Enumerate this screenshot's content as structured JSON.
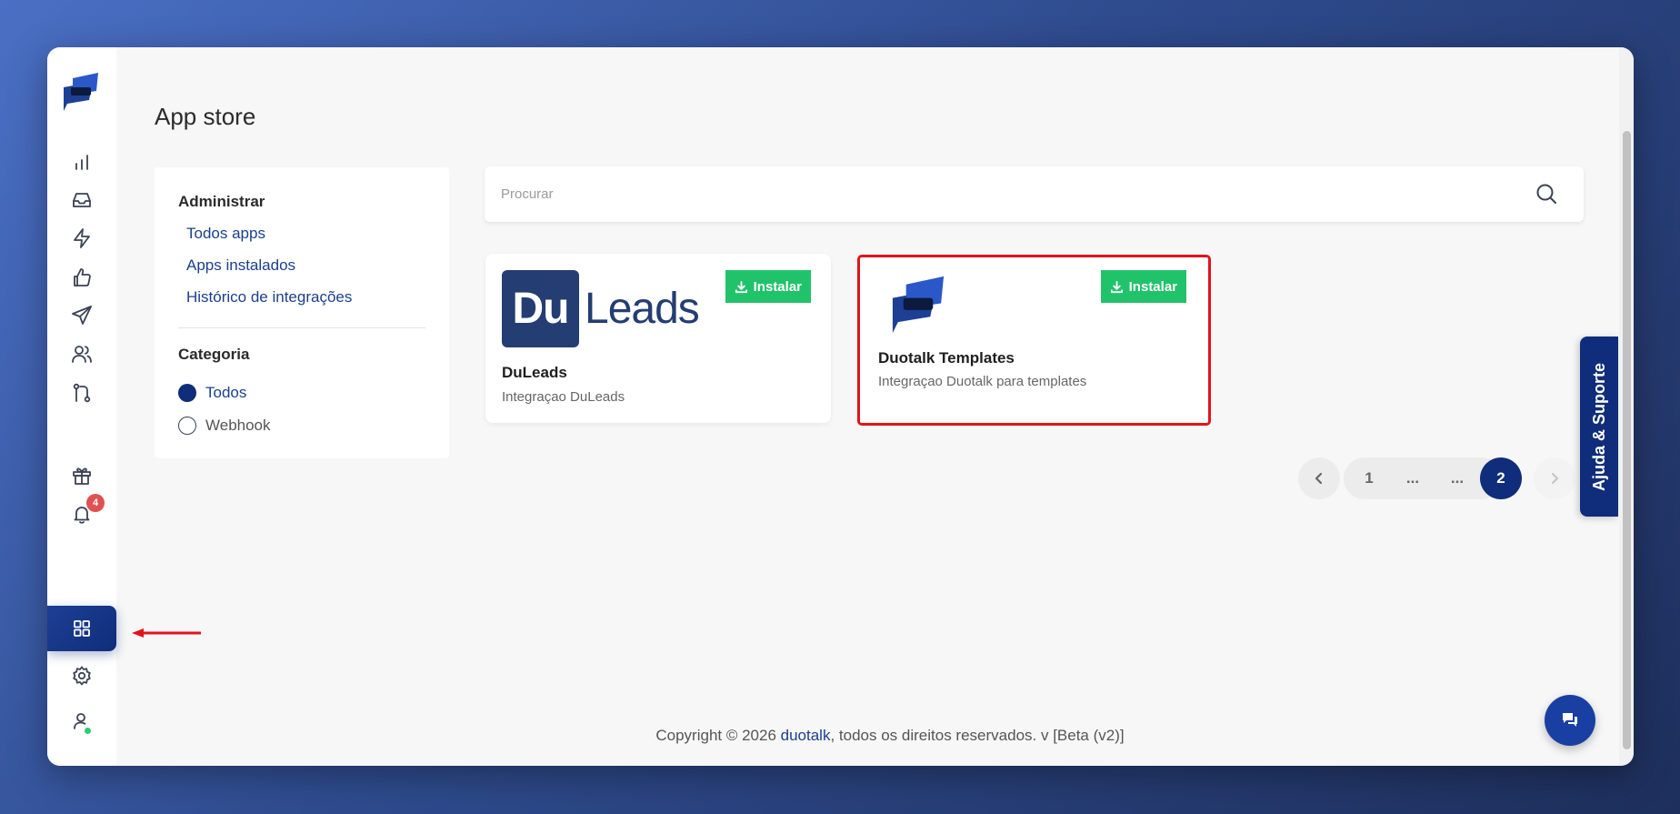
{
  "page": {
    "title": "App store"
  },
  "sidebar": {
    "notification_count": "4",
    "items": [
      {
        "name": "dashboard",
        "icon": "bar-chart-icon"
      },
      {
        "name": "inbox",
        "icon": "inbox-icon"
      },
      {
        "name": "automation",
        "icon": "lightning-icon"
      },
      {
        "name": "feedback",
        "icon": "thumbs-up-icon"
      },
      {
        "name": "campaigns",
        "icon": "send-icon"
      },
      {
        "name": "contacts",
        "icon": "users-icon"
      },
      {
        "name": "flows",
        "icon": "git-branch-icon"
      },
      {
        "name": "rewards",
        "icon": "gift-icon"
      },
      {
        "name": "notifications",
        "icon": "bell-icon"
      },
      {
        "name": "app-store",
        "icon": "grid-icon",
        "active": true
      },
      {
        "name": "settings",
        "icon": "gear-icon"
      },
      {
        "name": "profile",
        "icon": "user-icon"
      }
    ]
  },
  "filters": {
    "admin_heading": "Administrar",
    "links": [
      "Todos apps",
      "Apps instalados",
      "Histórico de integrações"
    ],
    "category_heading": "Categoria",
    "categories": [
      {
        "label": "Todos",
        "selected": true
      },
      {
        "label": "Webhook",
        "selected": false
      }
    ]
  },
  "search": {
    "placeholder": "Procurar",
    "value": ""
  },
  "apps": [
    {
      "name": "DuLeads",
      "description": "Integraçao DuLeads",
      "install_label": "Instalar",
      "logo_text_box": "Du",
      "logo_text": "Leads",
      "highlighted": false
    },
    {
      "name": "Duotalk Templates",
      "description": "Integraçao Duotalk para templates",
      "install_label": "Instalar",
      "highlighted": true
    }
  ],
  "pagination": {
    "pages": [
      "1",
      "...",
      "...",
      "2"
    ],
    "current": "2"
  },
  "help_tab": {
    "label": "Ajuda & Suporte"
  },
  "footer": {
    "prefix": "Copyright © 2026 ",
    "brand": "duotalk",
    "suffix": ", todos os direitos reservados. v [Beta (v2)]"
  },
  "colors": {
    "brand": "#0f2d7a",
    "install": "#21c36a",
    "highlight": "#e3131b",
    "badge": "#e05252",
    "online": "#2ecc71"
  }
}
